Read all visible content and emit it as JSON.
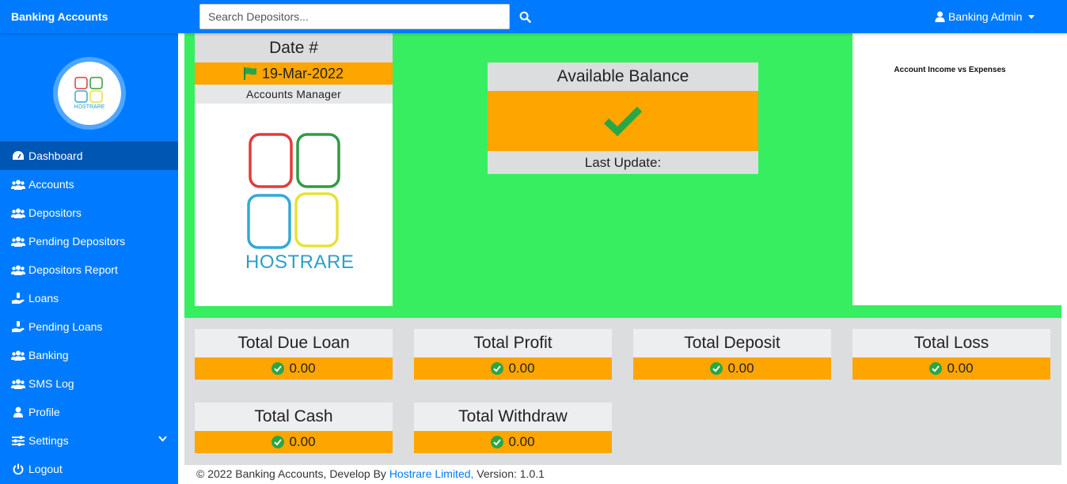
{
  "topbar": {
    "brand": "Banking Accounts",
    "search_placeholder": "Search Depositors...",
    "user_label": "Banking Admin"
  },
  "sidebar": {
    "logo_text": "HOSTRARE",
    "items": [
      {
        "label": "Dashboard",
        "icon": "dashboard-icon",
        "active": true
      },
      {
        "label": "Accounts",
        "icon": "users-icon"
      },
      {
        "label": "Depositors",
        "icon": "users-icon"
      },
      {
        "label": "Pending Depositors",
        "icon": "users-icon"
      },
      {
        "label": "Depositors Report",
        "icon": "users-icon"
      },
      {
        "label": "Loans",
        "icon": "hand-holding-icon"
      },
      {
        "label": "Pending Loans",
        "icon": "hand-holding-icon"
      },
      {
        "label": "Banking",
        "icon": "users-icon"
      },
      {
        "label": "SMS Log",
        "icon": "users-icon"
      },
      {
        "label": "Profile",
        "icon": "user-icon"
      },
      {
        "label": "Settings",
        "icon": "sliders-icon"
      },
      {
        "label": "Logout",
        "icon": "power-icon"
      }
    ]
  },
  "date_card": {
    "title": "Date #",
    "date": "19-Mar-2022",
    "role": "Accounts Manager",
    "logo_text": "HOSTRARE"
  },
  "balance_card": {
    "title": "Available Balance",
    "footer": "Last Update:"
  },
  "chart_card": {
    "title": "Account Income vs Expenses"
  },
  "stats": [
    {
      "label": "Total Due Loan",
      "value": "0.00"
    },
    {
      "label": "Total Profit",
      "value": "0.00"
    },
    {
      "label": "Total Deposit",
      "value": "0.00"
    },
    {
      "label": "Total Loss",
      "value": "0.00"
    },
    {
      "label": "Total Cash",
      "value": "0.00"
    },
    {
      "label": "Total Withdraw",
      "value": "0.00"
    }
  ],
  "footer": {
    "prefix": "© 2022 Banking Accounts, Develop By",
    "link": "Hostrare Limited,",
    "suffix": "Version: 1.0.1"
  },
  "colors": {
    "primary": "#007bff",
    "active_nav": "#0056b3",
    "green_panel": "#37ee60",
    "orange": "#ffa500",
    "check_green": "#28a745"
  }
}
